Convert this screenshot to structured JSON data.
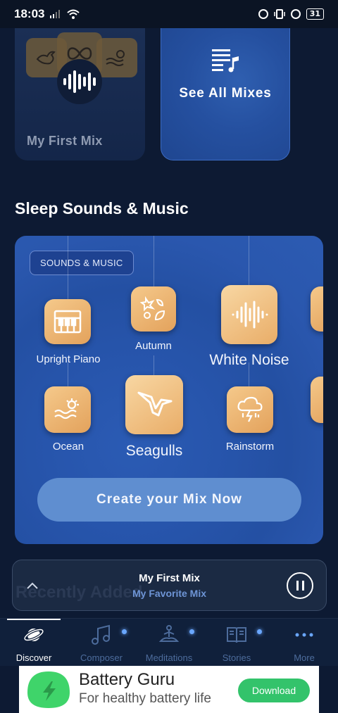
{
  "status_bar": {
    "time": "18:03",
    "battery": "31"
  },
  "my_mix_card": {
    "name": "My First Mix"
  },
  "all_mixes_card": {
    "label": "See All Mixes"
  },
  "section": {
    "title": "Sleep Sounds & Music"
  },
  "sound_panel": {
    "tag": "SOUNDS & MUSIC",
    "sounds": [
      {
        "label": "Upright Piano",
        "icon": "piano-icon"
      },
      {
        "label": "Autumn",
        "icon": "leaves-icon"
      },
      {
        "label": "White Noise",
        "icon": "sound-wave-icon"
      },
      {
        "label": "Ocean",
        "icon": "sun-waves-icon"
      },
      {
        "label": "Seagulls",
        "icon": "seagull-icon"
      },
      {
        "label": "Rainstorm",
        "icon": "storm-cloud-icon"
      }
    ],
    "cta": "Create your Mix Now"
  },
  "player": {
    "title": "My First Mix",
    "subtitle": "My Favorite Mix",
    "ghost_text": "Recently Added"
  },
  "tabs": [
    {
      "label": "Discover",
      "icon": "planet-icon",
      "active": true
    },
    {
      "label": "Composer",
      "icon": "music-note-icon"
    },
    {
      "label": "Meditations",
      "icon": "meditation-icon"
    },
    {
      "label": "Stories",
      "icon": "book-icon"
    },
    {
      "label": "More",
      "icon": "more-dots-icon"
    }
  ],
  "ad": {
    "title": "Battery Guru",
    "subtitle": "For healthy battery life",
    "button": "Download"
  },
  "colors": {
    "background": "#0d1a33",
    "panel": "#2755ac",
    "tile": "#eab372",
    "accent_blue": "#6e95d6",
    "ad_button": "#33c36b"
  }
}
